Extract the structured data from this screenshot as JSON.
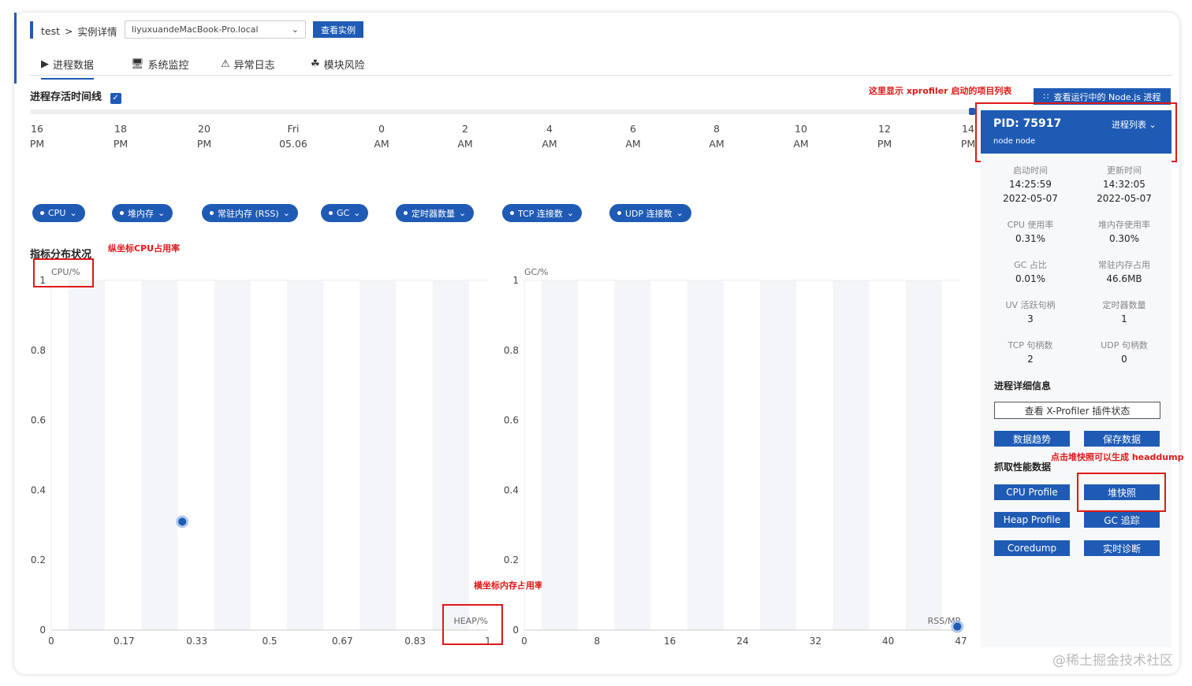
{
  "breadcrumb": {
    "root": "test",
    "sep": ">",
    "current": "实例详情"
  },
  "host_select": {
    "value": "liyuxuandeMacBook-Pro.local"
  },
  "view_instance_label": "查看实例",
  "tabs": [
    {
      "label": "进程数据",
      "icon": "play-icon"
    },
    {
      "label": "系统监控",
      "icon": "monitor-icon"
    },
    {
      "label": "异常日志",
      "icon": "warning-icon"
    },
    {
      "label": "模块风险",
      "icon": "cluster-icon"
    }
  ],
  "timeline": {
    "title": "进程存活时间线",
    "ticks": [
      {
        "top": "16",
        "bottom": "PM"
      },
      {
        "top": "18",
        "bottom": "PM"
      },
      {
        "top": "20",
        "bottom": "PM"
      },
      {
        "top": "Fri",
        "bottom": "05.06"
      },
      {
        "top": "0",
        "bottom": "AM"
      },
      {
        "top": "2",
        "bottom": "AM"
      },
      {
        "top": "4",
        "bottom": "AM"
      },
      {
        "top": "6",
        "bottom": "AM"
      },
      {
        "top": "8",
        "bottom": "AM"
      },
      {
        "top": "10",
        "bottom": "AM"
      },
      {
        "top": "12",
        "bottom": "PM"
      },
      {
        "top": "14",
        "bottom": "PM"
      }
    ]
  },
  "annotations": {
    "xprofiler_list": "这里显示 xprofiler 启动的项目列表",
    "y_axis_cpu": "纵坐标CPU占用率",
    "x_axis_heap": "横坐标内存占用率",
    "heapdump": "点击堆快照可以生成 headdump"
  },
  "view_running_label": "查看运行中的 Node.js 进程",
  "metric_pills": [
    "CPU",
    "堆内存",
    "常驻内存 (RSS)",
    "GC",
    "定时器数量",
    "TCP 连接数",
    "UDP 连接数"
  ],
  "distribution_title": "指标分布状况",
  "process_panel": {
    "pid": "PID: 75917",
    "list_label": "进程列表",
    "subtitle": "node node"
  },
  "stats": [
    {
      "label": "启动时间",
      "value": "14:25:59",
      "value2": "2022-05-07"
    },
    {
      "label": "更新时间",
      "value": "14:32:05",
      "value2": "2022-05-07"
    },
    {
      "label": "CPU 使用率",
      "value": "0.31%"
    },
    {
      "label": "堆内存使用率",
      "value": "0.30%"
    },
    {
      "label": "GC 占比",
      "value": "0.01%"
    },
    {
      "label": "常驻内存占用",
      "value": "46.6MB"
    },
    {
      "label": "UV 活跃句柄",
      "value": "3"
    },
    {
      "label": "定时器数量",
      "value": "1"
    },
    {
      "label": "TCP 句柄数",
      "value": "2"
    },
    {
      "label": "UDP 句柄数",
      "value": "0"
    }
  ],
  "detail_title": "进程详细信息",
  "xprofiler_status_label": "查看 X-Profiler 插件状态",
  "data_trend_label": "数据趋势",
  "save_data_label": "保存数据",
  "perf_title": "抓取性能数据",
  "perf_buttons": [
    "CPU Profile",
    "堆快照",
    "Heap Profile",
    "GC 追踪",
    "Coredump",
    "实时诊断"
  ],
  "watermark": "@稀土掘金技术社区",
  "colors": {
    "accent": "#1f5bb5",
    "annotation": "#e01818"
  },
  "chart_data": [
    {
      "type": "scatter",
      "ylabel": "CPU/%",
      "xlabel": "HEAP/%",
      "yticks": [
        "0",
        "0.2",
        "0.4",
        "0.6",
        "0.8",
        "1"
      ],
      "xticks": [
        "0",
        "0.17",
        "0.33",
        "0.5",
        "0.67",
        "0.83",
        "1"
      ],
      "xlim": [
        0,
        1
      ],
      "ylim": [
        0,
        1
      ],
      "points": [
        {
          "x": 0.3,
          "y": 0.31
        }
      ]
    },
    {
      "type": "scatter",
      "ylabel": "GC/%",
      "xlabel": "RSS/MB",
      "yticks": [
        "0",
        "0.2",
        "0.4",
        "0.6",
        "0.8",
        "1"
      ],
      "xticks": [
        "0",
        "8",
        "16",
        "24",
        "32",
        "40",
        "47"
      ],
      "xlim": [
        0,
        47
      ],
      "ylim": [
        0,
        1
      ],
      "points": [
        {
          "x": 46.6,
          "y": 0.01
        }
      ]
    }
  ]
}
